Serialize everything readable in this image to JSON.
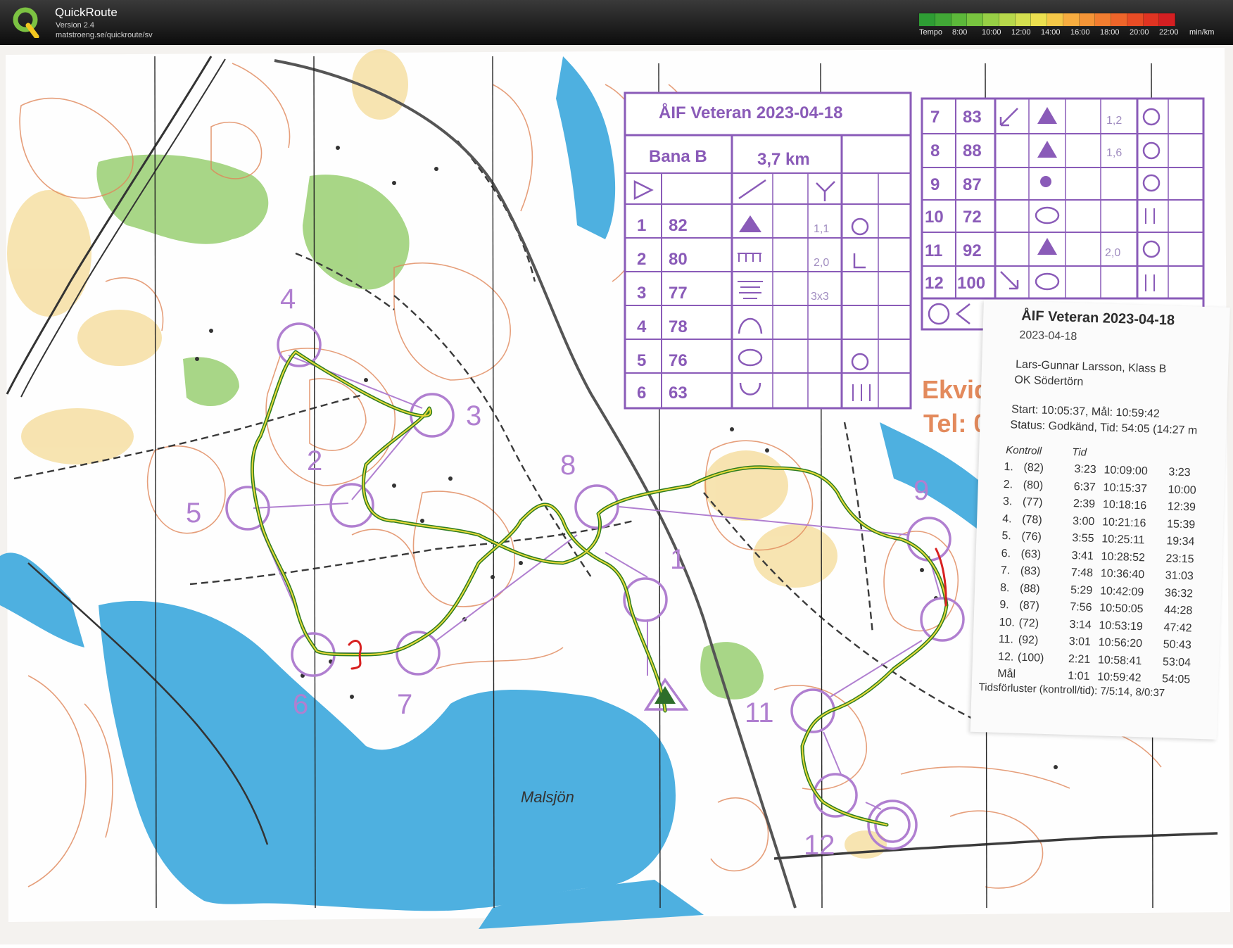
{
  "app": {
    "name": "QuickRoute",
    "version": "Version 2.4",
    "url": "matstroeng.se/quickroute/sv"
  },
  "tempo_legend": {
    "label": "Tempo",
    "ticks": [
      "8:00",
      "10:00",
      "12:00",
      "14:00",
      "16:00",
      "18:00",
      "20:00",
      "22:00"
    ],
    "unit": "min/km",
    "colors": [
      "#2e9d34",
      "#41a836",
      "#5cb83a",
      "#78c43f",
      "#97cf45",
      "#b7d84b",
      "#d4df4f",
      "#ece04f",
      "#f5c848",
      "#f7ad40",
      "#f59537",
      "#f27d30",
      "#ee652a",
      "#e84c25",
      "#e03422",
      "#d41f22"
    ]
  },
  "map": {
    "place_names": [
      "Malsjön"
    ],
    "partial_text": [
      "Ekvid",
      "Tel: 0"
    ],
    "control_numbers": [
      "1",
      "2",
      "3",
      "4",
      "5",
      "6",
      "7",
      "8",
      "9",
      "11",
      "12"
    ]
  },
  "course_card": {
    "title": "ÅIF Veteran 2023-04-18",
    "course": "Bana B",
    "length": "3,7 km",
    "rows": [
      {
        "n": "1",
        "code": "82",
        "size": "1,1"
      },
      {
        "n": "2",
        "code": "80",
        "size": "2,0"
      },
      {
        "n": "3",
        "code": "77",
        "size": "3x3"
      },
      {
        "n": "4",
        "code": "78",
        "size": ""
      },
      {
        "n": "5",
        "code": "76",
        "size": ""
      },
      {
        "n": "6",
        "code": "63",
        "size": ""
      }
    ],
    "rows_right": [
      {
        "n": "7",
        "code": "83",
        "size": "1,2"
      },
      {
        "n": "8",
        "code": "88",
        "size": "1,6"
      },
      {
        "n": "9",
        "code": "87",
        "size": ""
      },
      {
        "n": "10",
        "code": "72",
        "size": ""
      },
      {
        "n": "11",
        "code": "92",
        "size": "2,0"
      },
      {
        "n": "12",
        "code": "100",
        "size": ""
      }
    ]
  },
  "receipt": {
    "title": "ÅIF Veteran 2023-04-18",
    "date": "2023-04-18",
    "runner": "Lars-Gunnar Larsson, Klass B",
    "club": "OK Södertörn",
    "start": "Start: 10:05:37, Mål: 10:59:42",
    "status": "Status: Godkänd, Tid: 54:05 (14:27 m",
    "col_control": "Kontroll",
    "col_time": "Tid",
    "splits": [
      {
        "ctrl": "1.",
        "code": "(82)",
        "split": "3:23",
        "clock": "10:09:00",
        "total": "3:23"
      },
      {
        "ctrl": "2.",
        "code": "(80)",
        "split": "6:37",
        "clock": "10:15:37",
        "total": "10:00"
      },
      {
        "ctrl": "3.",
        "code": "(77)",
        "split": "2:39",
        "clock": "10:18:16",
        "total": "12:39"
      },
      {
        "ctrl": "4.",
        "code": "(78)",
        "split": "3:00",
        "clock": "10:21:16",
        "total": "15:39"
      },
      {
        "ctrl": "5.",
        "code": "(76)",
        "split": "3:55",
        "clock": "10:25:11",
        "total": "19:34"
      },
      {
        "ctrl": "6.",
        "code": "(63)",
        "split": "3:41",
        "clock": "10:28:52",
        "total": "23:15"
      },
      {
        "ctrl": "7.",
        "code": "(83)",
        "split": "7:48",
        "clock": "10:36:40",
        "total": "31:03"
      },
      {
        "ctrl": "8.",
        "code": "(88)",
        "split": "5:29",
        "clock": "10:42:09",
        "total": "36:32"
      },
      {
        "ctrl": "9.",
        "code": "(87)",
        "split": "7:56",
        "clock": "10:50:05",
        "total": "44:28"
      },
      {
        "ctrl": "10.",
        "code": "(72)",
        "split": "3:14",
        "clock": "10:53:19",
        "total": "47:42"
      },
      {
        "ctrl": "11.",
        "code": "(92)",
        "split": "3:01",
        "clock": "10:56:20",
        "total": "50:43"
      },
      {
        "ctrl": "12.",
        "code": "(100)",
        "split": "2:21",
        "clock": "10:58:41",
        "total": "53:04"
      },
      {
        "ctrl": "Mål",
        "code": "",
        "split": "1:01",
        "clock": "10:59:42",
        "total": "54:05"
      }
    ],
    "footer": "Tidsförluster (kontroll/tid): 7/5:14, 8/0:37"
  }
}
